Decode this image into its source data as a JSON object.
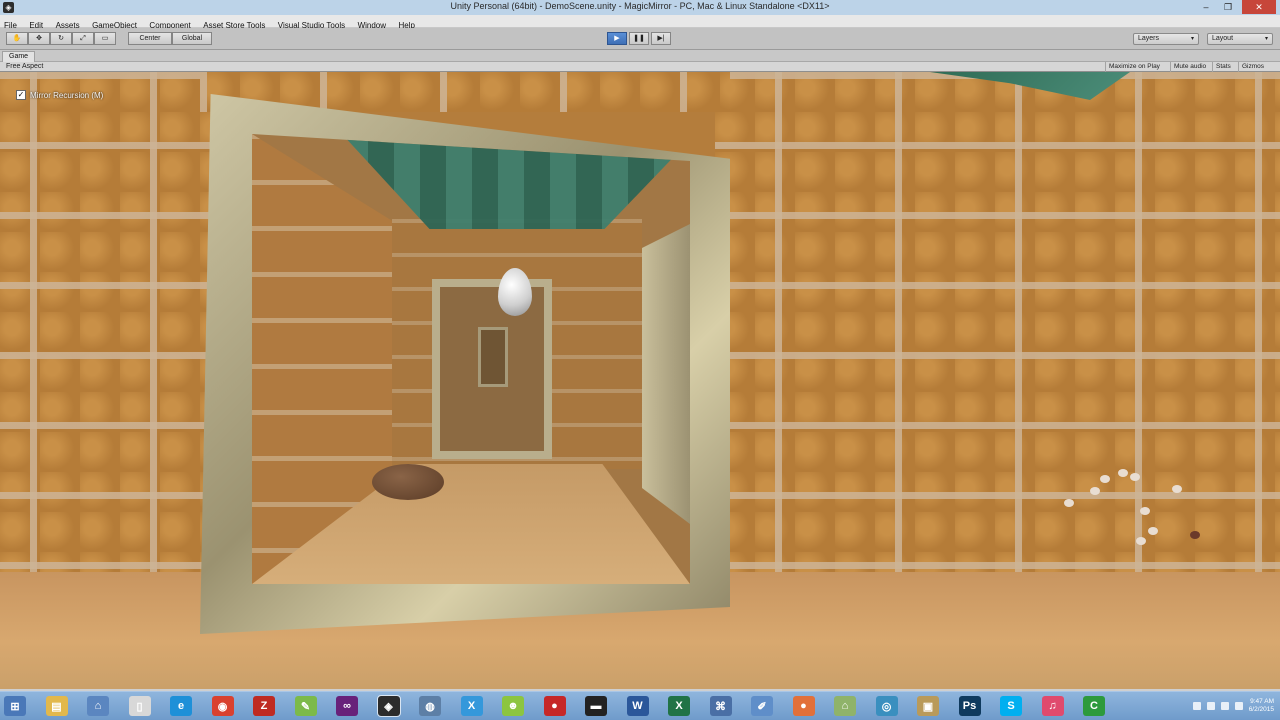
{
  "window": {
    "title": "Unity Personal (64bit) - DemoScene.unity - MagicMirror - PC, Mac & Linux Standalone <DX11>",
    "minimize": "–",
    "maximize": "❐",
    "close": "✕"
  },
  "menu": [
    "File",
    "Edit",
    "Assets",
    "GameObject",
    "Component",
    "Asset Store Tools",
    "Visual Studio Tools",
    "Window",
    "Help"
  ],
  "toolbar": {
    "pivot_label": "Center",
    "space_label": "Global",
    "play_icon": "▶",
    "pause_icon": "❚❚",
    "step_icon": "▶|",
    "layers_label": "Layers",
    "layout_label": "Layout"
  },
  "game_tab": {
    "label": "Game",
    "aspect": "Free Aspect",
    "buttons": [
      "Maximize on Play",
      "Mute audio",
      "Stats",
      "Gizmos"
    ]
  },
  "viewport": {
    "mirror_recursion_label": "Mirror Recursion (M)",
    "mirror_recursion_checked": true,
    "check_mark": "✓"
  },
  "taskbar": {
    "apps": [
      {
        "name": "start",
        "glyph": "⊞",
        "color": "#4a78b8"
      },
      {
        "name": "file-explorer",
        "glyph": "▤",
        "color": "#e2b84c"
      },
      {
        "name": "network",
        "glyph": "⌂",
        "color": "#5b86c0"
      },
      {
        "name": "document",
        "glyph": "▯",
        "color": "#d8d8d8"
      },
      {
        "name": "internet-explorer",
        "glyph": "e",
        "color": "#1e90d8"
      },
      {
        "name": "chrome",
        "glyph": "◉",
        "color": "#d9412f"
      },
      {
        "name": "filezilla",
        "glyph": "Z",
        "color": "#bf2b22"
      },
      {
        "name": "notepad-plus",
        "glyph": "✎",
        "color": "#7cba4a"
      },
      {
        "name": "visual-studio",
        "glyph": "∞",
        "color": "#68217a"
      },
      {
        "name": "unity",
        "glyph": "◈",
        "color": "#2c2c2c"
      },
      {
        "name": "monodevelop",
        "glyph": "◍",
        "color": "#5d7fa6"
      },
      {
        "name": "xamarin",
        "glyph": "X",
        "color": "#3498db"
      },
      {
        "name": "android",
        "glyph": "☻",
        "color": "#8cc540"
      },
      {
        "name": "record",
        "glyph": "●",
        "color": "#c62828"
      },
      {
        "name": "terminal",
        "glyph": "▬",
        "color": "#222222"
      },
      {
        "name": "word",
        "glyph": "W",
        "color": "#2b579a"
      },
      {
        "name": "excel",
        "glyph": "X",
        "color": "#217346"
      },
      {
        "name": "network-tool",
        "glyph": "⌘",
        "color": "#4a6fa5"
      },
      {
        "name": "paint",
        "glyph": "✐",
        "color": "#5f8ec9"
      },
      {
        "name": "orange-app",
        "glyph": "●",
        "color": "#e2703a"
      },
      {
        "name": "home",
        "glyph": "⌂",
        "color": "#8fb36a"
      },
      {
        "name": "globe",
        "glyph": "◎",
        "color": "#3a8fbf"
      },
      {
        "name": "archive",
        "glyph": "▣",
        "color": "#b99a5a"
      },
      {
        "name": "photoshop",
        "glyph": "Ps",
        "color": "#0f3a5e"
      },
      {
        "name": "skype",
        "glyph": "S",
        "color": "#00aff0"
      },
      {
        "name": "itunes",
        "glyph": "♫",
        "color": "#e04a6d"
      },
      {
        "name": "camtasia",
        "glyph": "C",
        "color": "#2d9a3c"
      }
    ],
    "clock_time": "9:47 AM",
    "clock_date": "6/2/2015"
  }
}
